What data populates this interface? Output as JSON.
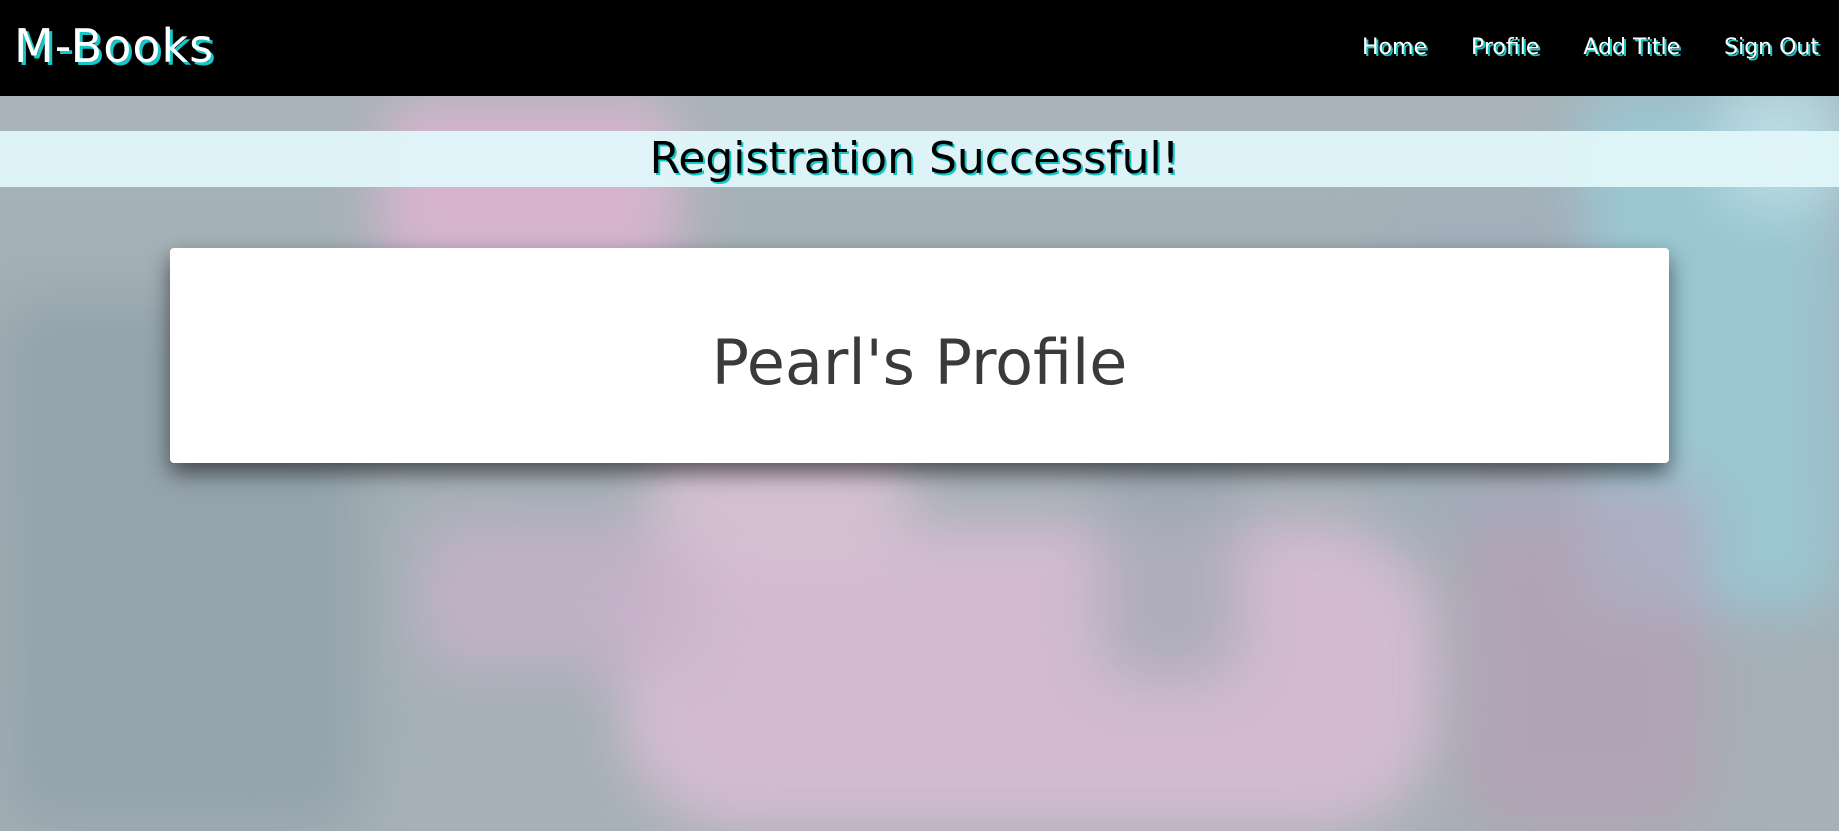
{
  "navbar": {
    "brand": "M-Books",
    "links": [
      {
        "label": "Home"
      },
      {
        "label": "Profile"
      },
      {
        "label": "Add Title"
      },
      {
        "label": "Sign Out"
      }
    ]
  },
  "flash": {
    "message": "Registration Successful!"
  },
  "profile": {
    "title": "Pearl's Profile"
  },
  "colors": {
    "navbar_bg": "#000000",
    "accent_shadow": "#17c7c7",
    "flash_bg": "#e0f7fa",
    "card_bg": "#ffffff",
    "card_text": "#3a3a3a"
  }
}
